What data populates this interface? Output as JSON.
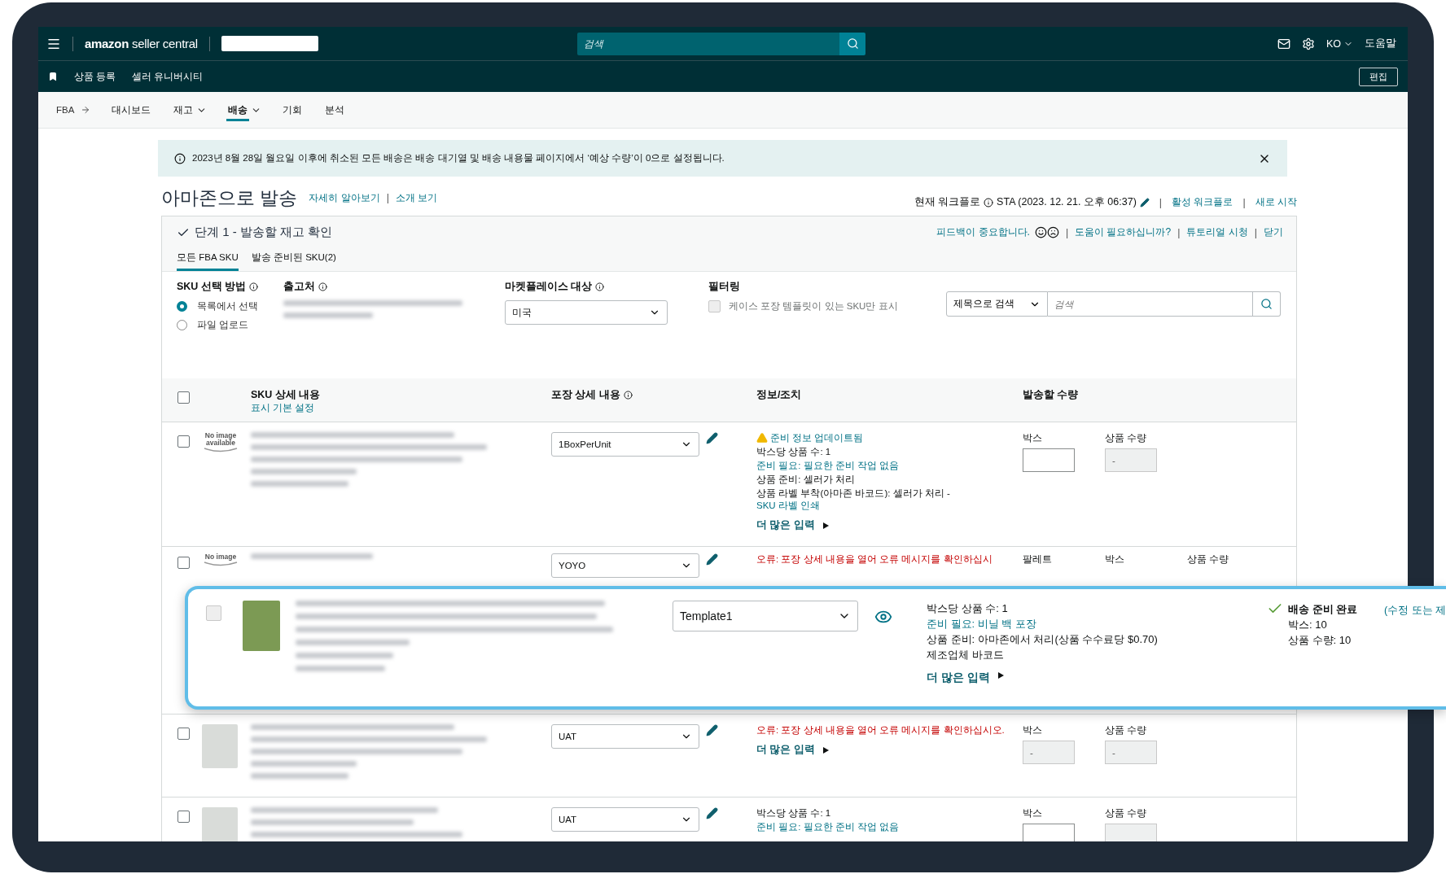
{
  "top_bar": {
    "logo_brand": "amazon",
    "logo_product": "seller central",
    "search_placeholder": "검색",
    "language": "KO",
    "help": "도움말"
  },
  "sub_bar": {
    "links": [
      "상품 등록",
      "셀러 유니버시티"
    ],
    "edit_button": "편집"
  },
  "nav": {
    "root": "FBA",
    "items": [
      {
        "label": "대시보드",
        "dropdown": false,
        "selected": false
      },
      {
        "label": "재고",
        "dropdown": true,
        "selected": false
      },
      {
        "label": "배송",
        "dropdown": true,
        "selected": true
      },
      {
        "label": "기회",
        "dropdown": false,
        "selected": false
      },
      {
        "label": "분석",
        "dropdown": false,
        "selected": false
      }
    ]
  },
  "banner": {
    "text": "2023년 8월 28일 월요일 이후에 취소된 모든 배송은 배송 대기열 및 배송 내용물 페이지에서 ‘예상 수량’이 0으로 설정됩니다."
  },
  "page_header": {
    "title": "아마존으로 발송",
    "links": [
      "자세히 알아보기",
      "소개 보기"
    ],
    "separator": "|",
    "workflow_label": "현재 워크플로",
    "workflow_value": "STA (2023. 12. 21. 오후 06:37)",
    "workflow_links": [
      "활성 워크플로",
      "새로 시작"
    ]
  },
  "step": {
    "title": "단계 1 - 발송할 재고 확인",
    "completed": true,
    "feedback": "피드백이 중요합니다.",
    "separator": "|",
    "links": [
      "도움이 필요하십니까?",
      "튜토리얼 시청",
      "닫기"
    ],
    "tabs": [
      {
        "label": "모든 FBA SKU",
        "selected": true
      },
      {
        "label": "발송 준비된 SKU(2)",
        "selected": false
      }
    ]
  },
  "form": {
    "sku_method_label": "SKU 선택 방법",
    "sku_method_options": [
      {
        "label": "목록에서 선택",
        "selected": true
      },
      {
        "label": "파일 업로드",
        "selected": false
      }
    ],
    "ship_from_label": "출고처",
    "marketplace_label": "마켓플레이스 대상",
    "marketplace_value": "미국",
    "filter_label": "필터링",
    "filter_checkbox": {
      "label": "케이스 포장 템플릿이 있는 SKU만 표시",
      "checked": false,
      "disabled": true
    },
    "search_mode": "제목으로 검색",
    "search_placeholder": "검색"
  },
  "table": {
    "select_all_checked": false,
    "columns": [
      "SKU 상세 내용",
      "포장 상세 내용",
      "정보/조치",
      "발송할 수량"
    ],
    "sku_sub_link": "표시 기본 설정",
    "rows": [
      {
        "checked": false,
        "image_text": "No image available",
        "packing": "1BoxPerUnit",
        "info": [
          {
            "kind": "warning",
            "text": "준비 정보 업데이트됨"
          },
          {
            "kind": "text",
            "text": "박스당 상품 수: 1"
          },
          {
            "kind": "link",
            "text": "준비 필요: 필요한 준비 작업 없음"
          },
          {
            "kind": "text",
            "text": "상품 준비: 셀러가 처리"
          },
          {
            "kind": "text",
            "text": "상품 라벨 부착(아마존 바코드): 셀러가 처리 - ",
            "link": "SKU 라벨 인쇄"
          }
        ],
        "more": "더 많은 입력",
        "quantity": [
          {
            "label": "박스",
            "disabled": false
          },
          {
            "label": "상품 수량",
            "value": "-",
            "disabled": true
          }
        ]
      },
      {
        "checked": false,
        "image_text": "No image",
        "packing": "YOYO",
        "info": [
          {
            "kind": "error",
            "text": "오류: 포장 상세 내용을 열어 오류 메시지를 확인하십시"
          }
        ],
        "quantity": [
          {
            "label": "팔레트"
          },
          {
            "label": "박스"
          },
          {
            "label": "상품 수량"
          }
        ]
      },
      {
        "checked": false,
        "packing": "UAT",
        "info": [
          {
            "kind": "error",
            "text": "오류: 포장 상세 내용을 열어 오류 메시지를 확인하십시오."
          }
        ],
        "more": "더 많은 입력",
        "quantity": [
          {
            "label": "박스",
            "value": "-",
            "disabled": true
          },
          {
            "label": "상품 수량",
            "value": "-",
            "disabled": true
          }
        ]
      },
      {
        "checked": false,
        "packing": "UAT",
        "info": [
          {
            "kind": "text",
            "text": "박스당 상품 수: 1"
          },
          {
            "kind": "link",
            "text": "준비 필요: 필요한 준비 작업 없음"
          }
        ],
        "quantity": [
          {
            "label": "박스",
            "disabled": false
          },
          {
            "label": "상품 수량",
            "disabled": true
          }
        ]
      }
    ]
  },
  "highlight": {
    "checked": false,
    "disabled": true,
    "packing": "Template1",
    "info": [
      {
        "kind": "text",
        "text": "박스당 상품 수: 1"
      },
      {
        "kind": "link",
        "text": "준비 필요: 비닐 백 포장"
      },
      {
        "kind": "text",
        "text": "상품 준비: 아마존에서 처리(상품 수수료당 $0.70)"
      },
      {
        "kind": "text",
        "text": "제조업체 바코드"
      }
    ],
    "more": "더 많은 입력",
    "status": {
      "title": "배송 준비 완료",
      "link": "(수정 또는 제",
      "lines": [
        "박스: 10",
        "상품 수량: 10"
      ]
    }
  }
}
